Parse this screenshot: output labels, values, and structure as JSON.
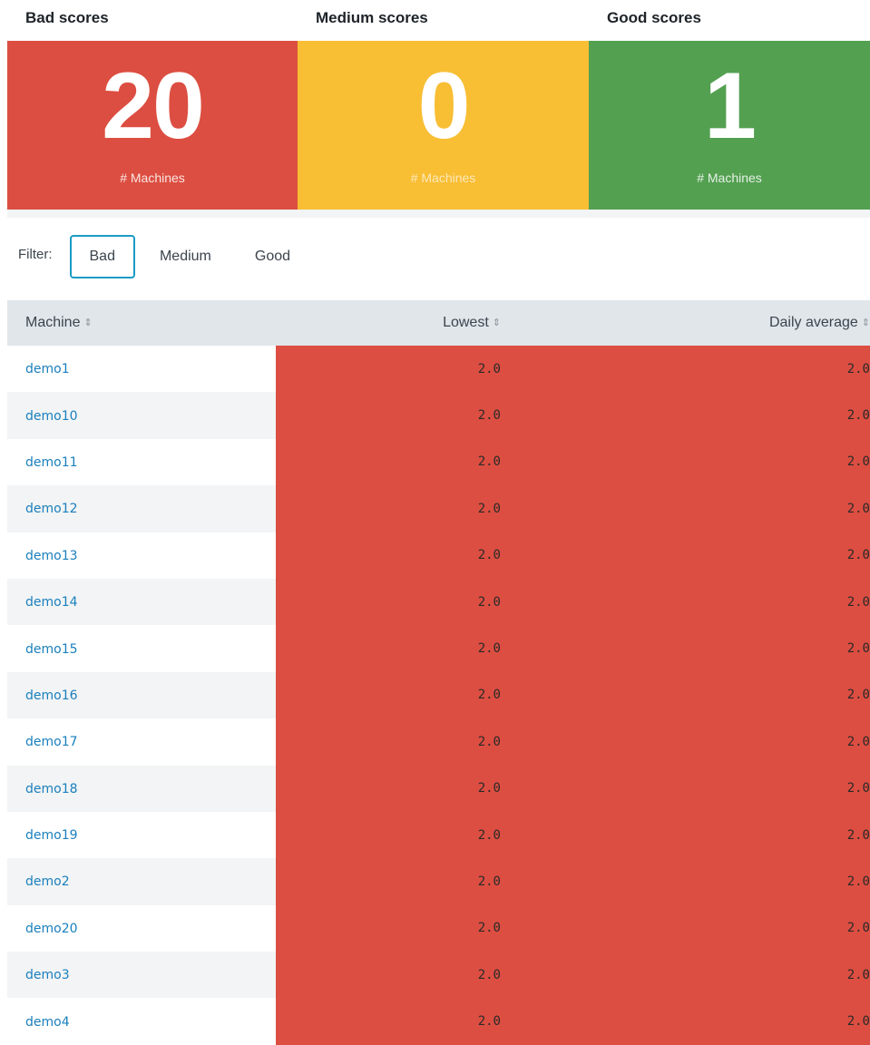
{
  "colors": {
    "bad": "#dc4e41",
    "medium": "#f8be34",
    "good": "#53a051",
    "link": "#1a7fbd",
    "active_border": "#1a9bc4",
    "header_bg": "#e1e6eb",
    "row_alt_bg": "#f2f4f5"
  },
  "panels": [
    {
      "title": "Bad scores",
      "value": "20",
      "unit": "# Machines",
      "color": "#dc4e41"
    },
    {
      "title": "Medium scores",
      "value": "0",
      "unit": "# Machines",
      "color": "#f8be34"
    },
    {
      "title": "Good scores",
      "value": "1",
      "unit": "# Machines",
      "color": "#53a051"
    }
  ],
  "filter": {
    "label": "Filter:",
    "options": [
      "Bad",
      "Medium",
      "Good"
    ],
    "selected": "Bad"
  },
  "table": {
    "columns": [
      "Machine",
      "Lowest",
      "Daily average"
    ],
    "sort_icon": "sort-both-icon",
    "sort_glyph": "⇕",
    "rows": [
      {
        "machine": "demo1",
        "lowest": "2.0",
        "daily_average": "2.0"
      },
      {
        "machine": "demo10",
        "lowest": "2.0",
        "daily_average": "2.0"
      },
      {
        "machine": "demo11",
        "lowest": "2.0",
        "daily_average": "2.0"
      },
      {
        "machine": "demo12",
        "lowest": "2.0",
        "daily_average": "2.0"
      },
      {
        "machine": "demo13",
        "lowest": "2.0",
        "daily_average": "2.0"
      },
      {
        "machine": "demo14",
        "lowest": "2.0",
        "daily_average": "2.0"
      },
      {
        "machine": "demo15",
        "lowest": "2.0",
        "daily_average": "2.0"
      },
      {
        "machine": "demo16",
        "lowest": "2.0",
        "daily_average": "2.0"
      },
      {
        "machine": "demo17",
        "lowest": "2.0",
        "daily_average": "2.0"
      },
      {
        "machine": "demo18",
        "lowest": "2.0",
        "daily_average": "2.0"
      },
      {
        "machine": "demo19",
        "lowest": "2.0",
        "daily_average": "2.0"
      },
      {
        "machine": "demo2",
        "lowest": "2.0",
        "daily_average": "2.0"
      },
      {
        "machine": "demo20",
        "lowest": "2.0",
        "daily_average": "2.0"
      },
      {
        "machine": "demo3",
        "lowest": "2.0",
        "daily_average": "2.0"
      },
      {
        "machine": "demo4",
        "lowest": "2.0",
        "daily_average": "2.0"
      }
    ]
  }
}
